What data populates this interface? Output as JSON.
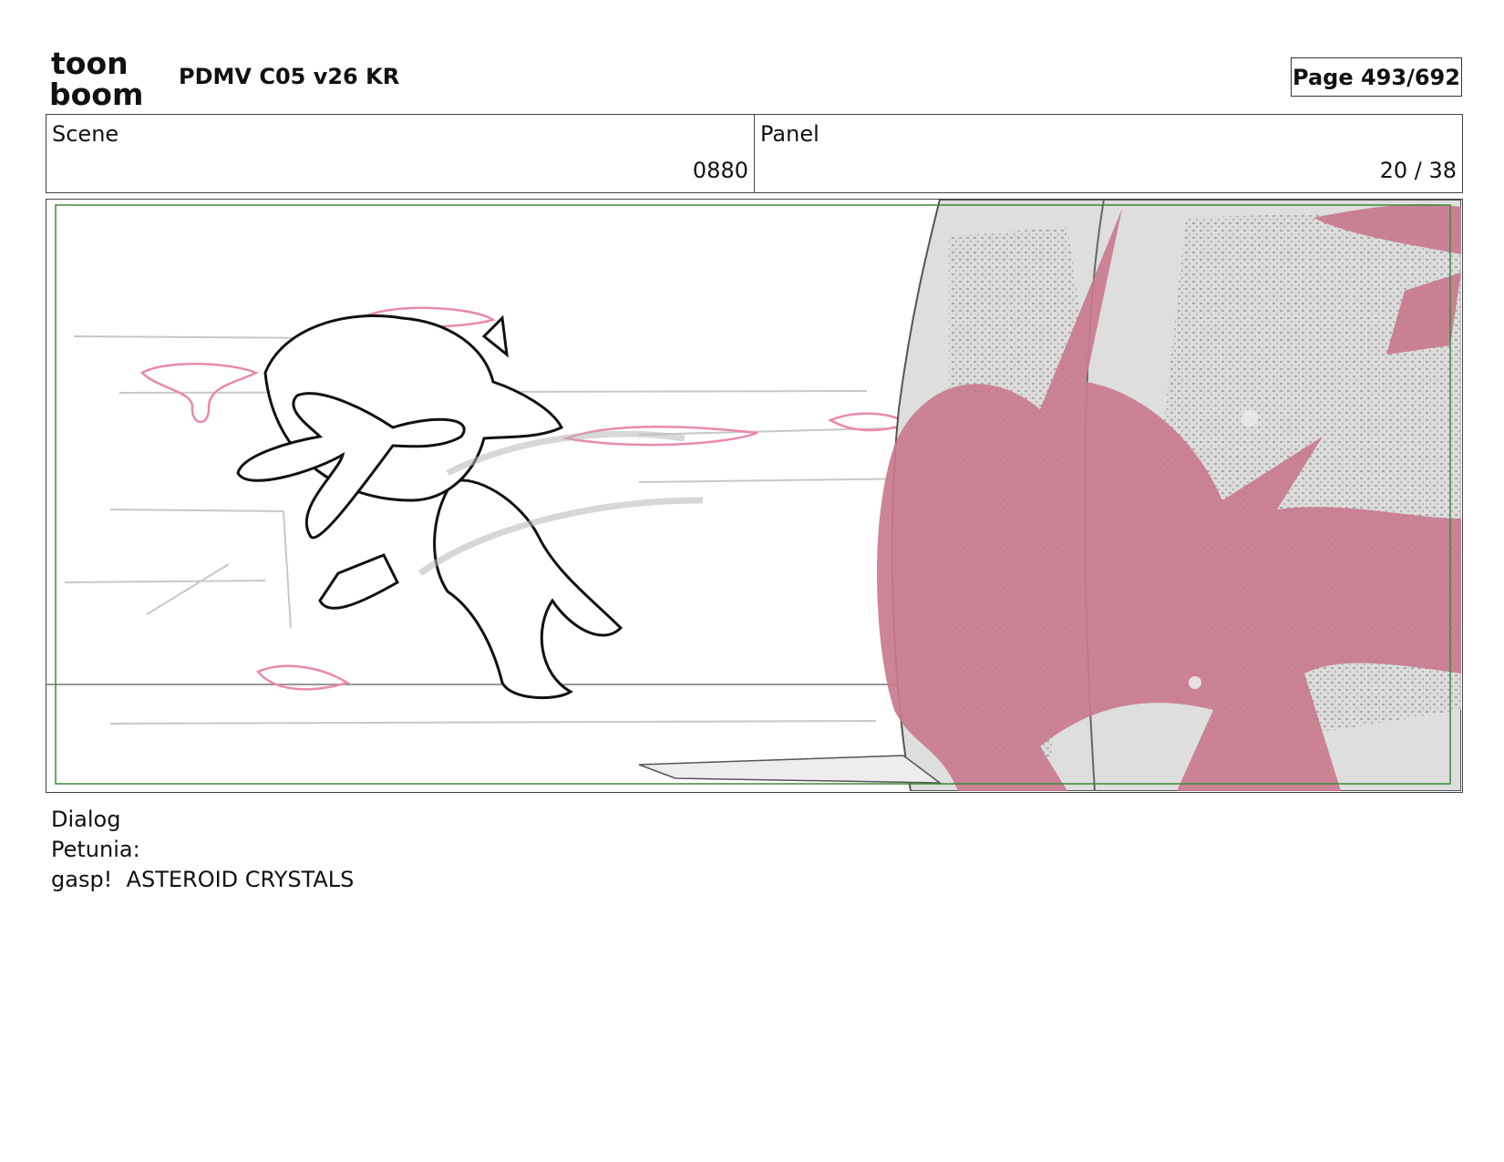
{
  "header": {
    "logo_top": "toon",
    "logo_bottom": "boom",
    "title": "PDMV C05 v26 KR",
    "page": "Page 493/692"
  },
  "info": {
    "scene_label": "Scene",
    "scene_value": "0880",
    "panel_label": "Panel",
    "panel_value": "20 / 38"
  },
  "dialog": {
    "label": "Dialog",
    "speaker": "Petunia:",
    "line": "gasp!  ASTEROID CRYSTALS"
  },
  "colors": {
    "safe_frame": "#3a8a3a",
    "goo_pink": "#c97a8e",
    "rough_pink": "#e98aa8",
    "rock_gray": "#dcdcdc"
  }
}
